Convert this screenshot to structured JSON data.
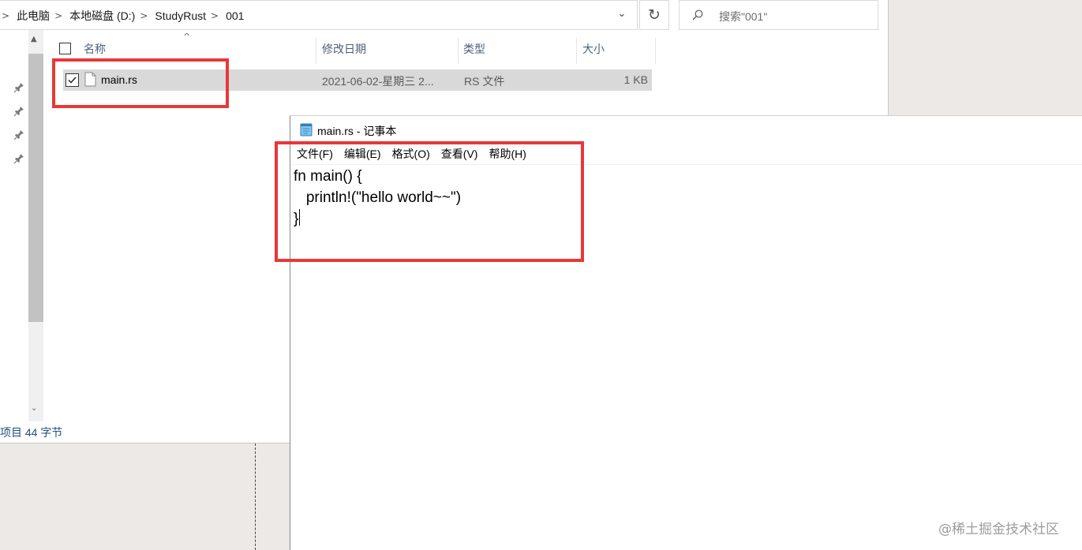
{
  "explorer": {
    "breadcrumb": [
      "此电脑",
      "本地磁盘 (D:)",
      "StudyRust",
      "001"
    ],
    "search_placeholder": "搜索\"001\"",
    "columns": {
      "name": "名称",
      "modified": "修改日期",
      "type": "类型",
      "size": "大小"
    },
    "files": [
      {
        "name": "main.rs",
        "modified": "2021-06-02-星期三 2...",
        "type": "RS 文件",
        "size": "1 KB",
        "selected": true
      }
    ],
    "status_text": "项目  44 字节"
  },
  "notepad": {
    "title": "main.rs - 记事本",
    "menu": [
      "文件(F)",
      "编辑(E)",
      "格式(O)",
      "查看(V)",
      "帮助(H)"
    ],
    "lines": [
      "fn main() {",
      "   println!(\"hello world~~\")",
      "}"
    ]
  },
  "watermark": "@稀土掘金技术社区",
  "colors": {
    "highlight_box": "#e8373a",
    "selected_row": "#d9d9d9"
  }
}
